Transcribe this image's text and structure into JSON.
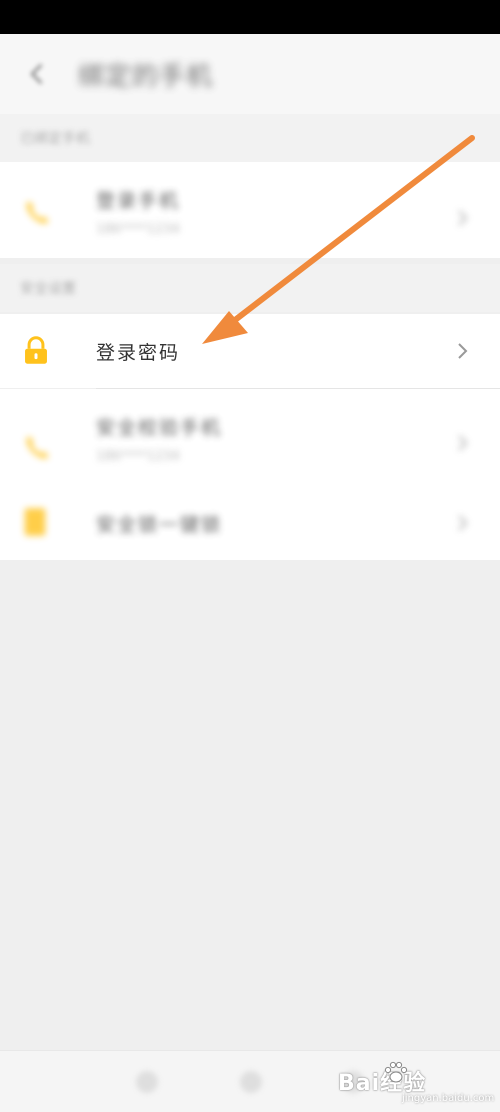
{
  "header": {
    "title": "绑定的手机"
  },
  "section1": {
    "header": "已绑定手机",
    "item": {
      "title": "登录手机",
      "subtitle": "186****1234",
      "icon": "phone-icon"
    }
  },
  "section2": {
    "header": "安全设置",
    "items": [
      {
        "title": "登录密码",
        "icon": "lock-icon"
      },
      {
        "title": "安全校验手机",
        "subtitle": "186****1234",
        "icon": "phone-icon"
      },
      {
        "title": "安全锁一键锁",
        "icon": "document-icon"
      }
    ]
  },
  "watermark": {
    "brand": "Bai经验",
    "url": "jingyan.baidu.com"
  },
  "colors": {
    "accent": "#FFC21C",
    "arrow": "#F08A3C",
    "chevron": "#999999"
  }
}
